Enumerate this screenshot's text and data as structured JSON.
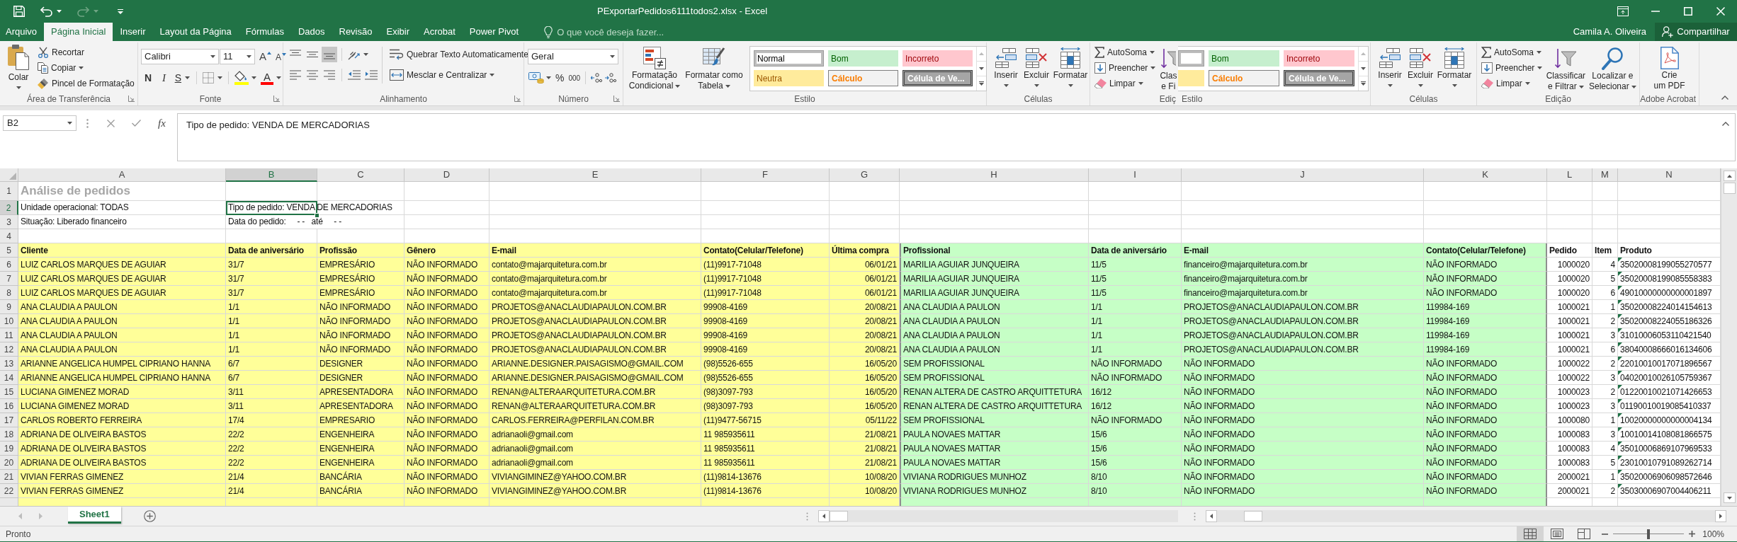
{
  "title_bar": {
    "quick_access": [
      {
        "kind": "save",
        "disabled": false
      },
      {
        "kind": "undo",
        "disabled": false
      },
      {
        "kind": "redo",
        "disabled": true
      }
    ],
    "title": "PExportarPedidos6111todos2.xlsx - Excel"
  },
  "menu_tabs": [
    {
      "label": "Arquivo",
      "selected": false
    },
    {
      "label": "Página Inicial",
      "selected": true
    },
    {
      "label": "Inserir",
      "selected": false
    },
    {
      "label": "Layout da Página",
      "selected": false
    },
    {
      "label": "Fórmulas",
      "selected": false
    },
    {
      "label": "Dados",
      "selected": false
    },
    {
      "label": "Revisão",
      "selected": false
    },
    {
      "label": "Exibir",
      "selected": false
    },
    {
      "label": "Acrobat",
      "selected": false
    },
    {
      "label": "Power Pivot",
      "selected": false
    }
  ],
  "tell_me": {
    "placeholder": "O que você deseja fazer..."
  },
  "account": {
    "user": "Camila A. Oliveira",
    "share": "Compartilhar"
  },
  "ribbon": {
    "clipboard": {
      "paste": "Colar",
      "cut": "Recortar",
      "copy": "Copiar",
      "format_painter": "Pincel de Formatação",
      "label": "Área de Transferência"
    },
    "font": {
      "name": "Calibri",
      "size": "11",
      "grow": "A",
      "shrink": "A",
      "bold": "N",
      "italic": "I",
      "underline": "S",
      "font_color": "A",
      "label": "Fonte"
    },
    "alignment": {
      "vertical": [
        {
          "kind": "top",
          "selected": false
        },
        {
          "kind": "middle",
          "selected": false
        },
        {
          "kind": "bottom",
          "selected": true
        }
      ],
      "horizontal": [
        {
          "kind": "left",
          "selected": false
        },
        {
          "kind": "center",
          "selected": false
        },
        {
          "kind": "right",
          "selected": false
        }
      ],
      "wrap": "Quebrar Texto Automaticamente",
      "merge": "Mesclar e Centralizar",
      "label": "Alinhamento"
    },
    "number": {
      "format": "Geral",
      "percent": "%",
      "thousands": "000",
      "label": "Número"
    },
    "styles": {
      "conditional": [
        "Formatação",
        "Condicional"
      ],
      "table": [
        "Formatar como",
        "Tabela"
      ],
      "gallery": [
        {
          "label": "Normal",
          "kind": "normal",
          "selected": true
        },
        {
          "label": "Bom",
          "kind": "good",
          "selected": false
        },
        {
          "label": "Incorreto",
          "kind": "bad",
          "selected": false
        },
        {
          "label": "Neutra",
          "kind": "neutral",
          "selected": false
        },
        {
          "label": "Cálculo",
          "kind": "calculation",
          "selected": false
        },
        {
          "label": "Célula de Ve...",
          "kind": "check",
          "selected": false
        }
      ],
      "label": "Estilo"
    },
    "cells": {
      "insert": "Inserir",
      "delete": "Excluir",
      "format": "Formatar",
      "label": "Células"
    },
    "editing_partial": {
      "autosum": "AutoSoma",
      "fill": "Preencher",
      "clear": "Limpar",
      "sort": [
        "Clas",
        "e Fi"
      ],
      "label": "Ediç"
    },
    "styles_partial": {
      "gallery": [
        {
          "kind": "normal",
          "selected": true
        },
        {
          "label": "Bom",
          "kind": "good",
          "selected": false
        },
        {
          "label": "Incorreto",
          "kind": "bad",
          "selected": false
        },
        {
          "kind": "neutral",
          "selected": false
        },
        {
          "label": "Cálculo",
          "kind": "calculation",
          "selected": false
        },
        {
          "label": "Célula de Ve...",
          "kind": "check",
          "selected": false
        }
      ],
      "label": "Estilo"
    },
    "cells_2": {
      "insert": "Inserir",
      "delete": "Excluir",
      "format": "Formatar",
      "label": "Células"
    },
    "editing": {
      "autosum": "AutoSoma",
      "fill": "Preencher",
      "clear": "Limpar",
      "sort": [
        "Classificar",
        "e Filtrar"
      ],
      "find": [
        "Localizar e",
        "Selecionar"
      ],
      "label": "Edição"
    },
    "acrobat": {
      "create_pdf": [
        "Crie",
        "um PDF"
      ],
      "label": "Adobe Acrobat"
    }
  },
  "formula_bar": {
    "name_box": "B2",
    "function": "fx",
    "formula": "Tipo de pedido: VENDA DE MERCADORIAS"
  },
  "sheet": {
    "columns": [
      {
        "label": "A",
        "selected": false
      },
      {
        "label": "B",
        "selected": true
      },
      {
        "label": "C",
        "selected": false
      },
      {
        "label": "D",
        "selected": false
      },
      {
        "label": "E",
        "selected": false
      },
      {
        "label": "F",
        "selected": false
      },
      {
        "label": "G",
        "selected": false
      },
      {
        "label": "H",
        "selected": false
      },
      {
        "label": "I",
        "selected": false
      },
      {
        "label": "J",
        "selected": false
      },
      {
        "label": "K",
        "selected": false
      },
      {
        "label": "L",
        "selected": false
      },
      {
        "label": "M",
        "selected": false
      },
      {
        "label": "N",
        "selected": false
      }
    ],
    "row_headers": [
      {
        "number": "1",
        "selected": false
      },
      {
        "number": "2",
        "selected": true
      },
      {
        "number": "3",
        "selected": false
      },
      {
        "number": "4",
        "selected": false
      },
      {
        "number": "5",
        "selected": false
      },
      {
        "number": "6",
        "selected": false
      },
      {
        "number": "7",
        "selected": false
      },
      {
        "number": "8",
        "selected": false
      },
      {
        "number": "9",
        "selected": false
      },
      {
        "number": "10",
        "selected": false
      },
      {
        "number": "11",
        "selected": false
      },
      {
        "number": "12",
        "selected": false
      },
      {
        "number": "13",
        "selected": false
      },
      {
        "number": "14",
        "selected": false
      },
      {
        "number": "15",
        "selected": false
      },
      {
        "number": "16",
        "selected": false
      },
      {
        "number": "17",
        "selected": false
      },
      {
        "number": "18",
        "selected": false
      },
      {
        "number": "19",
        "selected": false
      },
      {
        "number": "20",
        "selected": false
      },
      {
        "number": "21",
        "selected": false
      },
      {
        "number": "22",
        "selected": false
      }
    ],
    "report": {
      "title": "Análise de pedidos",
      "unit": "Unidade operacional: TODAS",
      "order_type": "Tipo de pedido: VENDA DE MERCADORIAS",
      "status": "Situação: Liberado financeiro",
      "order_date": "Data do pedido:     - -   até     - -"
    },
    "table": {
      "header": [
        "Cliente",
        "Data de aniversário",
        "Profissão",
        "Gênero",
        "E-mail",
        "Contato(Celular/Telefone)",
        "Última compra",
        "Profissional",
        "Data de aniversário",
        "E-mail",
        "Contato(Celular/Telefone)",
        "Pedido",
        "Item",
        "Produto"
      ],
      "rows": [
        [
          "LUIZ CARLOS MARQUES DE AGUIAR",
          "31/7",
          "EMPRESÁRIO",
          "NÃO INFORMADO",
          "contato@majarquitetura.com.br",
          "(11)9917-71048",
          "06/01/21",
          "MARILIA AGUIAR JUNQUEIRA",
          "11/5",
          "financeiro@majarquitetura.com.br",
          "NÃO INFORMADO",
          "1000020",
          "4",
          "35020008199055270577"
        ],
        [
          "LUIZ CARLOS MARQUES DE AGUIAR",
          "31/7",
          "EMPRESÁRIO",
          "NÃO INFORMADO",
          "contato@majarquitetura.com.br",
          "(11)9917-71048",
          "06/01/21",
          "MARILIA AGUIAR JUNQUEIRA",
          "11/5",
          "financeiro@majarquitetura.com.br",
          "NÃO INFORMADO",
          "1000020",
          "5",
          "35020008199085558383"
        ],
        [
          "LUIZ CARLOS MARQUES DE AGUIAR",
          "31/7",
          "EMPRESÁRIO",
          "NÃO INFORMADO",
          "contato@majarquitetura.com.br",
          "(11)9917-71048",
          "06/01/21",
          "MARILIA AGUIAR JUNQUEIRA",
          "11/5",
          "financeiro@majarquitetura.com.br",
          "NÃO INFORMADO",
          "1000020",
          "6",
          "49010000000000001897"
        ],
        [
          "ANA CLAUDIA A PAULON",
          "1/1",
          "NÃO INFORMADO",
          "NÃO INFORMADO",
          "PROJETOS@ANACLAUDIAPAULON.COM.BR",
          "99908-4169",
          "20/08/21",
          "ANA CLAUDIA A PAULON",
          "1/1",
          "PROJETOS@ANACLAUDIAPAULON.COM.BR",
          "119984-169",
          "1000021",
          "1",
          "35020008224014154613"
        ],
        [
          "ANA CLAUDIA A PAULON",
          "1/1",
          "NÃO INFORMADO",
          "NÃO INFORMADO",
          "PROJETOS@ANACLAUDIAPAULON.COM.BR",
          "99908-4169",
          "20/08/21",
          "ANA CLAUDIA A PAULON",
          "1/1",
          "PROJETOS@ANACLAUDIAPAULON.COM.BR",
          "119984-169",
          "1000021",
          "2",
          "35020008224055186326"
        ],
        [
          "ANA CLAUDIA A PAULON",
          "1/1",
          "NÃO INFORMADO",
          "NÃO INFORMADO",
          "PROJETOS@ANACLAUDIAPAULON.COM.BR",
          "99908-4169",
          "20/08/21",
          "ANA CLAUDIA A PAULON",
          "1/1",
          "PROJETOS@ANACLAUDIAPAULON.COM.BR",
          "119984-169",
          "1000021",
          "3",
          "31010006053110421540"
        ],
        [
          "ANA CLAUDIA A PAULON",
          "1/1",
          "NÃO INFORMADO",
          "NÃO INFORMADO",
          "PROJETOS@ANACLAUDIAPAULON.COM.BR",
          "99908-4169",
          "20/08/21",
          "ANA CLAUDIA A PAULON",
          "1/1",
          "PROJETOS@ANACLAUDIAPAULON.COM.BR",
          "119984-169",
          "1000021",
          "6",
          "38040008666016134606"
        ],
        [
          "ARIANNE ANGELICA HUMPEL CIPRIANO HANNA",
          "6/7",
          "DESIGNER",
          "NÃO INFORMADO",
          "ARIANNE.DESIGNER.PAISAGISMO@GMAIL.COM",
          "(98)5526-655",
          "16/05/20",
          "SEM PROFISSIONAL",
          "NÃO INFORMADO",
          "NÃO INFORMADO",
          "NÃO INFORMADO",
          "1000022",
          "2",
          "22010010017071896567"
        ],
        [
          "ARIANNE ANGELICA HUMPEL CIPRIANO HANNA",
          "6/7",
          "DESIGNER",
          "NÃO INFORMADO",
          "ARIANNE.DESIGNER.PAISAGISMO@GMAIL.COM",
          "(98)5526-655",
          "16/05/20",
          "SEM PROFISSIONAL",
          "NÃO INFORMADO",
          "NÃO INFORMADO",
          "NÃO INFORMADO",
          "1000022",
          "3",
          "04020010026105759367"
        ],
        [
          "LUCIANA GIMENEZ MORAD",
          "3/11",
          "APRESENTADORA",
          "NÃO INFORMADO",
          "RENAN@ALTERAARQUITETURA.COM.BR",
          "(98)3097-793",
          "16/05/20",
          "RENAN ALTERA DE CASTRO ARQUITTETURA",
          "16/12",
          "NÃO INFORMADO",
          "NÃO INFORMADO",
          "1000023",
          "2",
          "01220010021071426653"
        ],
        [
          "LUCIANA GIMENEZ MORAD",
          "3/11",
          "APRESENTADORA",
          "NÃO INFORMADO",
          "RENAN@ALTERAARQUITETURA.COM.BR",
          "(98)3097-793",
          "16/05/20",
          "RENAN ALTERA DE CASTRO ARQUITTETURA",
          "16/12",
          "NÃO INFORMADO",
          "NÃO INFORMADO",
          "1000023",
          "3",
          "01190010019085410337"
        ],
        [
          "CARLOS ROBERTO FERREIRA",
          "17/4",
          "EMPRESARIO",
          "NÃO INFORMADO",
          "CARLOS.FERREIRA@PERFILAN.COM.BR",
          "(11)9477-56715",
          "05/11/22",
          "SEM PROFISSIONAL",
          "NÃO INFORMADO",
          "NÃO INFORMADO",
          "NÃO INFORMADO",
          "1000080",
          "1",
          "10020000000000004134"
        ],
        [
          "ADRIANA DE OLIVEIRA BASTOS",
          "22/2",
          "ENGENHEIRA",
          "NÃO INFORMADO",
          "adrianaoli@gmail.com",
          "11 985935611",
          "21/08/21",
          "PAULA NOVAES MATTAR",
          "15/6",
          "NÃO INFORMADO",
          "NÃO INFORMADO",
          "1000083",
          "3",
          "10010014108081866575"
        ],
        [
          "ADRIANA DE OLIVEIRA BASTOS",
          "22/2",
          "ENGENHEIRA",
          "NÃO INFORMADO",
          "adrianaoli@gmail.com",
          "11 985935611",
          "21/08/21",
          "PAULA NOVAES MATTAR",
          "15/6",
          "NÃO INFORMADO",
          "NÃO INFORMADO",
          "1000083",
          "4",
          "35010006869107969533"
        ],
        [
          "ADRIANA DE OLIVEIRA BASTOS",
          "22/2",
          "ENGENHEIRA",
          "NÃO INFORMADO",
          "adrianaoli@gmail.com",
          "11 985935611",
          "21/08/21",
          "PAULA NOVAES MATTAR",
          "15/6",
          "NÃO INFORMADO",
          "NÃO INFORMADO",
          "1000083",
          "5",
          "23010010791089262714"
        ],
        [
          "VIVIAN FERRAS GIMENEZ",
          "21/4",
          "BANCÁRIA",
          "NÃO INFORMADO",
          "VIVIANGIMINEZ@YAHOO.COM.BR",
          "(11)9814-13676",
          "10/08/20",
          "VIVIANA RODRIGUES MUNHOZ",
          "8/10",
          "NÃO INFORMADO",
          "NÃO INFORMADO",
          "2000021",
          "1",
          "35020006906098572646"
        ],
        [
          "VIVIAN FERRAS GIMENEZ",
          "21/4",
          "BANCÁRIA",
          "NÃO INFORMADO",
          "VIVIANGIMINEZ@YAHOO.COM.BR",
          "(11)9814-13676",
          "10/08/20",
          "VIVIANA RODRIGUES MUNHOZ",
          "8/10",
          "NÃO INFORMADO",
          "NÃO INFORMADO",
          "2000021",
          "2",
          "35030006907004406211"
        ]
      ]
    }
  },
  "sheet_tabs": [
    {
      "label": "Sheet1",
      "selected": true
    }
  ],
  "status_bar": {
    "status": "Pronto",
    "views": [
      {
        "kind": "normal",
        "selected": true
      },
      {
        "kind": "page_layout",
        "selected": false
      },
      {
        "kind": "page_break",
        "selected": false
      }
    ],
    "zoom": {
      "level": 0.5,
      "reading": "100%"
    }
  }
}
